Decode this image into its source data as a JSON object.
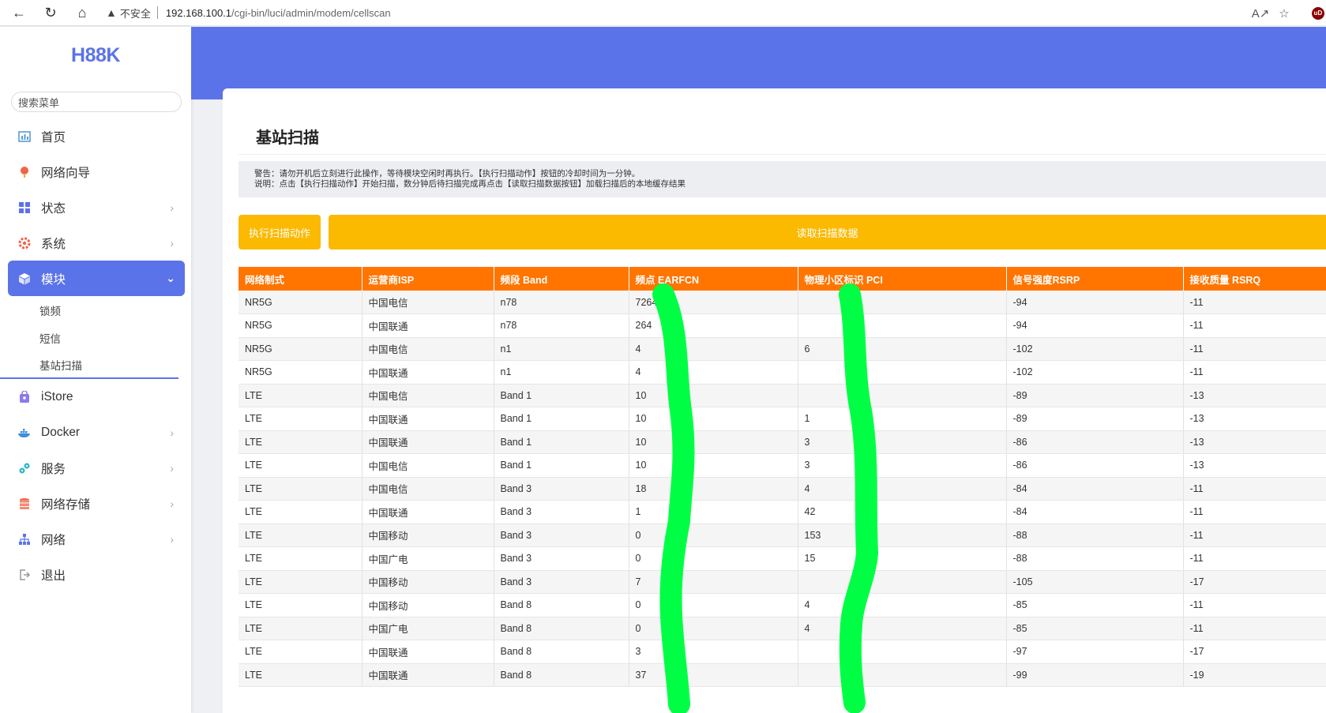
{
  "browser": {
    "insecure_label": "不安全",
    "url_host": "192.168.100.1",
    "url_path": "/cgi-bin/luci/admin/modem/cellscan"
  },
  "sidebar": {
    "logo": "H88K",
    "search_placeholder": "搜索菜单",
    "items": [
      {
        "label": "首页",
        "icon": "dashboard-icon"
      },
      {
        "label": "网络向导",
        "icon": "wizard-icon"
      },
      {
        "label": "状态",
        "icon": "grid-icon"
      },
      {
        "label": "系统",
        "icon": "gear-icon"
      },
      {
        "label": "模块",
        "icon": "cube-icon"
      },
      {
        "label": "iStore",
        "icon": "store-icon"
      },
      {
        "label": "Docker",
        "icon": "docker-icon"
      },
      {
        "label": "服务",
        "icon": "services-icon"
      },
      {
        "label": "网络存储",
        "icon": "storage-icon"
      },
      {
        "label": "网络",
        "icon": "network-icon"
      },
      {
        "label": "退出",
        "icon": "logout-icon"
      }
    ],
    "submenu": [
      "锁频",
      "短信",
      "基站扫描"
    ]
  },
  "page": {
    "title": "基站扫描",
    "notice_line1": "警告：请勿开机后立刻进行此操作，等待模块空闲时再执行。【执行扫描动作】按钮的冷却时间为一分钟。",
    "notice_line2": "说明：点击【执行扫描动作】开始扫描，数分钟后待扫描完成再点击【读取扫描数据按钮】加载扫描后的本地缓存结果",
    "scan_button": "执行扫描动作",
    "read_button": "读取扫描数据"
  },
  "table": {
    "headers": [
      "网络制式",
      "运营商ISP",
      "频段 Band",
      "频点 EARFCN",
      "物理小区标识 PCI",
      "信号强度RSRP",
      "接收质量 RSRQ"
    ],
    "rows": [
      [
        "NR5G",
        "中国电信",
        "n78",
        "7264",
        "",
        "-94",
        "-11"
      ],
      [
        "NR5G",
        "中国联通",
        "n78",
        "264",
        "",
        "-94",
        "-11"
      ],
      [
        "NR5G",
        "中国电信",
        "n1",
        "4",
        "6",
        "-102",
        "-11"
      ],
      [
        "NR5G",
        "中国联通",
        "n1",
        "4",
        "",
        "-102",
        "-11"
      ],
      [
        "LTE",
        "中国电信",
        "Band 1",
        "10",
        "",
        "-89",
        "-13"
      ],
      [
        "LTE",
        "中国联通",
        "Band 1",
        "10",
        "1",
        "-89",
        "-13"
      ],
      [
        "LTE",
        "中国联通",
        "Band 1",
        "10",
        "3",
        "-86",
        "-13"
      ],
      [
        "LTE",
        "中国电信",
        "Band 1",
        "10",
        "3",
        "-86",
        "-13"
      ],
      [
        "LTE",
        "中国电信",
        "Band 3",
        "18",
        "4",
        "-84",
        "-11"
      ],
      [
        "LTE",
        "中国联通",
        "Band 3",
        "1",
        "42",
        "-84",
        "-11"
      ],
      [
        "LTE",
        "中国移动",
        "Band 3",
        "0",
        "153",
        "-88",
        "-11"
      ],
      [
        "LTE",
        "中国广电",
        "Band 3",
        "0",
        "15",
        "-88",
        "-11"
      ],
      [
        "LTE",
        "中国移动",
        "Band 3",
        "7",
        "",
        "-105",
        "-17"
      ],
      [
        "LTE",
        "中国移动",
        "Band 8",
        "0",
        "4",
        "-85",
        "-11"
      ],
      [
        "LTE",
        "中国广电",
        "Band 8",
        "0",
        "4",
        "-85",
        "-11"
      ],
      [
        "LTE",
        "中国联通",
        "Band 8",
        "3",
        "",
        "-97",
        "-17"
      ],
      [
        "LTE",
        "中国联通",
        "Band 8",
        "37",
        "",
        "-99",
        "-19"
      ]
    ]
  },
  "colors": {
    "accent": "#5b73e8",
    "button": "#fbb900",
    "table_header": "#ff7500",
    "redaction": "#00ff44"
  }
}
